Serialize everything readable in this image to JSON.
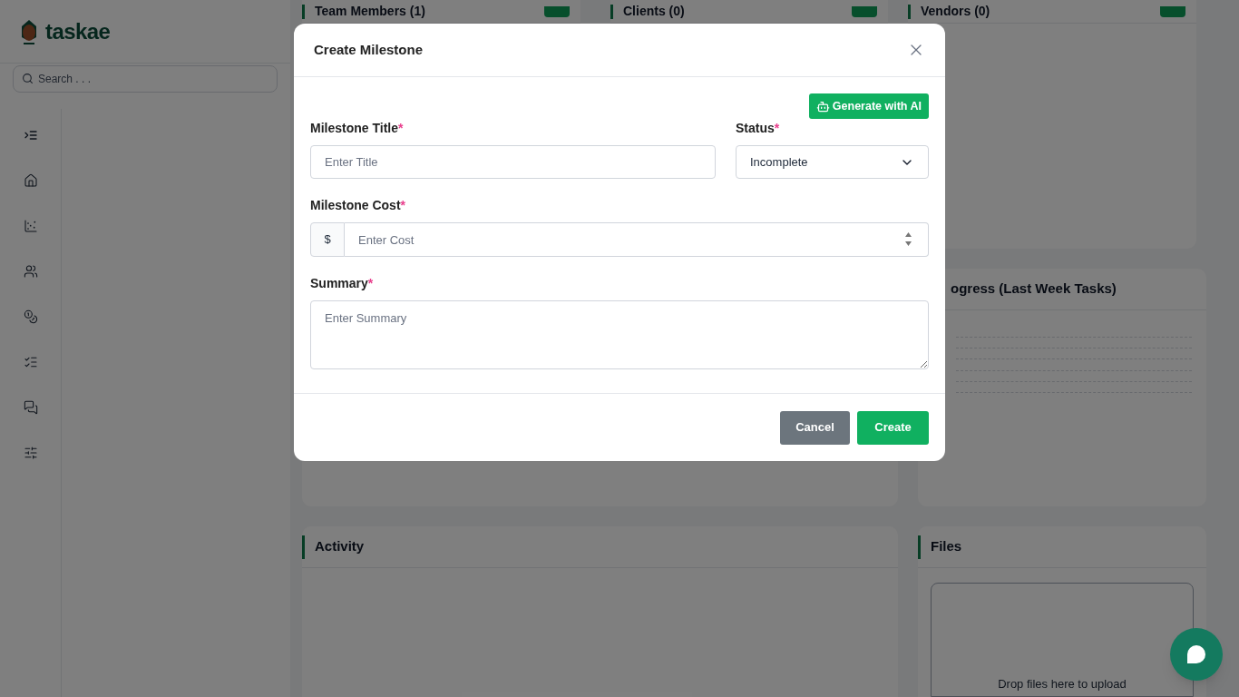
{
  "brand": {
    "name": "taskae"
  },
  "search": {
    "placeholder": "Search . . ."
  },
  "rail": [
    {
      "kind": "indent",
      "selected": false
    },
    {
      "kind": "home",
      "selected": false
    },
    {
      "kind": "chart",
      "selected": false
    },
    {
      "kind": "users",
      "selected": false
    },
    {
      "kind": "coins",
      "selected": false
    },
    {
      "kind": "checklist",
      "selected": false
    },
    {
      "kind": "messages",
      "selected": false
    },
    {
      "kind": "sliders",
      "selected": false
    }
  ],
  "top_cards": [
    {
      "title": "Team Members (1)"
    },
    {
      "title": "Clients (0)"
    },
    {
      "title": "Vendors (0)"
    }
  ],
  "progress_card": {
    "title": "ogress (Last Week Tasks)"
  },
  "activity_card": {
    "title": "Activity"
  },
  "files_card": {
    "title": "Files",
    "dropzone": "Drop files here to upload"
  },
  "modal": {
    "title": "Create Milestone",
    "ai_button": "Generate with AI",
    "fields": [
      {
        "label": "Milestone Title",
        "placeholder": "Enter Title"
      },
      {
        "label": "Status",
        "value": "Incomplete"
      },
      {
        "label": "Milestone Cost",
        "prefix": "$",
        "placeholder": "Enter Cost"
      },
      {
        "label": "Summary",
        "placeholder": "Enter Summary"
      }
    ],
    "required_mark": "*",
    "buttons": [
      {
        "label": "Cancel",
        "kind": "secondary"
      },
      {
        "label": "Create",
        "kind": "primary"
      }
    ]
  }
}
